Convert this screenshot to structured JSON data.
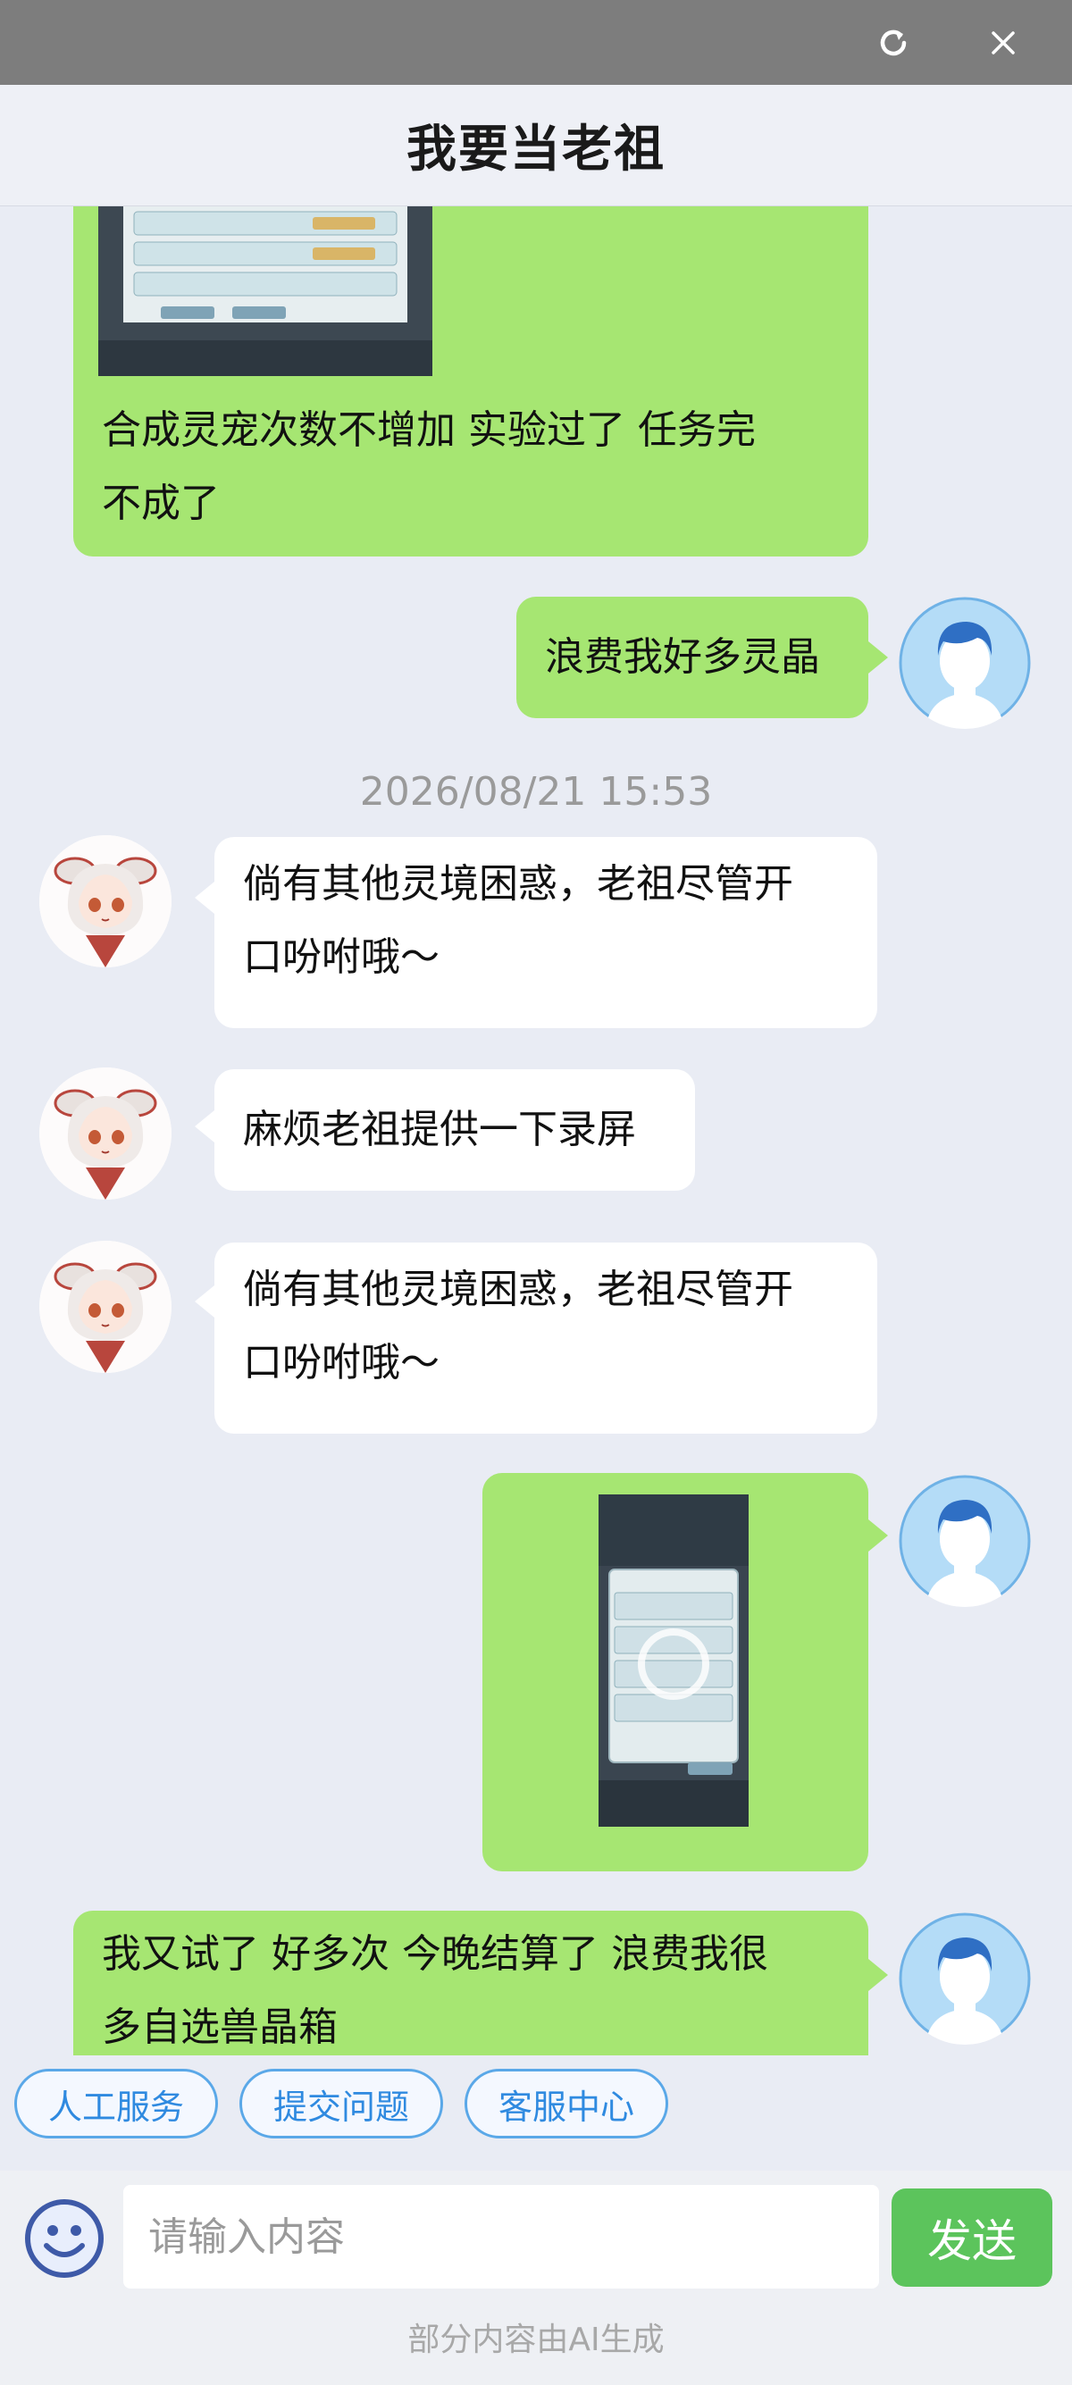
{
  "window": {
    "title": "我要当老祖",
    "refresh_icon": "refresh-icon",
    "close_icon": "close-icon"
  },
  "messages": [
    {
      "side": "user",
      "text_line1": "合成灵宠次数不增加 实验过了 任务完",
      "text_line2": "不成了"
    },
    {
      "side": "user",
      "text": "浪费我好多灵晶"
    },
    {
      "timestamp": "2026/08/21 15:53"
    },
    {
      "side": "bot",
      "text_line1": "倘有其他灵境困惑，老祖尽管开",
      "text_line2": "口吩咐哦～"
    },
    {
      "side": "bot",
      "text": "麻烦老祖提供一下录屏"
    },
    {
      "side": "bot",
      "text_line1": "倘有其他灵境困惑，老祖尽管开",
      "text_line2": "口吩咐哦～"
    },
    {
      "side": "user",
      "type": "image"
    },
    {
      "side": "user",
      "text_line1": "我又试了 好多次 今晚结算了 浪费我很",
      "text_line2": "多自选兽晶箱"
    }
  ],
  "quick_actions": [
    "人工服务",
    "提交问题",
    "客服中心"
  ],
  "composer": {
    "placeholder": "请输入内容",
    "send_label": "发送",
    "emoji_icon": "emoji-icon"
  },
  "footer": {
    "disclaimer": "部分内容由AI生成"
  },
  "colors": {
    "user_bubble": "#a6e672",
    "bot_bubble": "#ffffff",
    "send_button": "#5cc45c",
    "quick_button_border": "#5aa8e8"
  }
}
